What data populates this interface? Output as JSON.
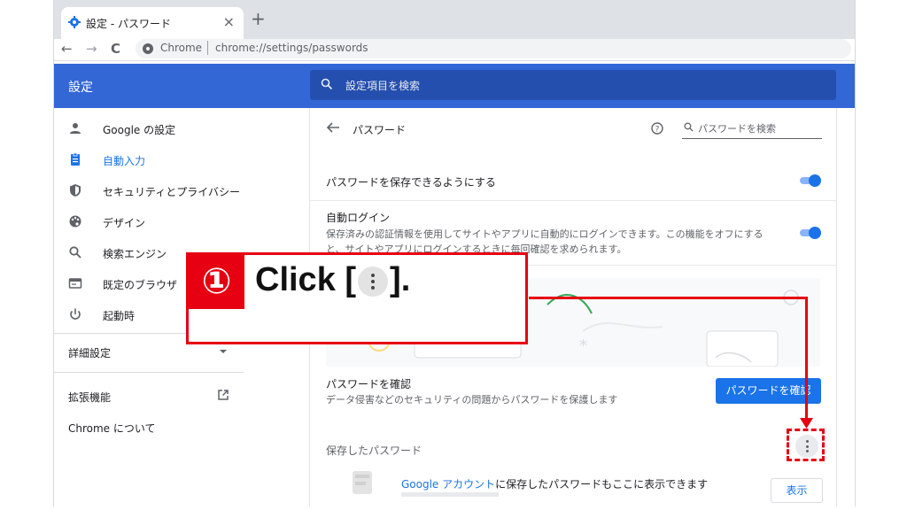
{
  "browser": {
    "tab_title": "設定 - パスワード",
    "tab_close": "×",
    "new_tab": "+",
    "back": "←",
    "forward": "→",
    "reload": "C",
    "site_label": "Chrome",
    "url": "chrome://settings/passwords"
  },
  "header": {
    "title": "設定",
    "search_placeholder": "設定項目を検索"
  },
  "sidebar": {
    "items": [
      {
        "label": "Google の設定",
        "icon": "person-icon"
      },
      {
        "label": "自動入力",
        "icon": "autofill-icon",
        "active": true
      },
      {
        "label": "セキュリティとプライバシー",
        "icon": "shield-icon"
      },
      {
        "label": "デザイン",
        "icon": "palette-icon"
      },
      {
        "label": "検索エンジン",
        "icon": "search-icon"
      },
      {
        "label": "既定のブラウザ",
        "icon": "browser-icon"
      },
      {
        "label": "起動時",
        "icon": "power-icon"
      }
    ],
    "advanced": "詳細設定",
    "extensions": "拡張機能",
    "about": "Chrome について"
  },
  "main": {
    "page_title": "パスワード",
    "password_search_placeholder": "パスワードを検索",
    "offer_to_save": {
      "label": "パスワードを保存できるようにする",
      "enabled": true
    },
    "auto_signin": {
      "label": "自動ログイン",
      "description_line1": "保存済みの認証情報を使用してサイトやアプリに自動的にログインできます。この機能をオフにする",
      "description_line2": "と、サイトやアプリにログインするときに毎回確認を求められます。",
      "enabled": true
    },
    "illustration_password": "****|",
    "check_passwords": {
      "title": "パスワードを確認",
      "description": "データ侵害などのセキュリティの問題からパスワードを保護します",
      "button": "パスワードを確認"
    },
    "saved_passwords": {
      "title": "保存したパスワード",
      "google_account_link": "Google アカウント",
      "note": "に保存したパスワードもここに表示できます",
      "show_button": "表示"
    }
  },
  "callout": {
    "number": "①",
    "text_before": "Click [",
    "text_after": "]."
  },
  "colors": {
    "accent": "#1a73e8",
    "header": "#3367d6",
    "annotation_red": "#e60012"
  }
}
